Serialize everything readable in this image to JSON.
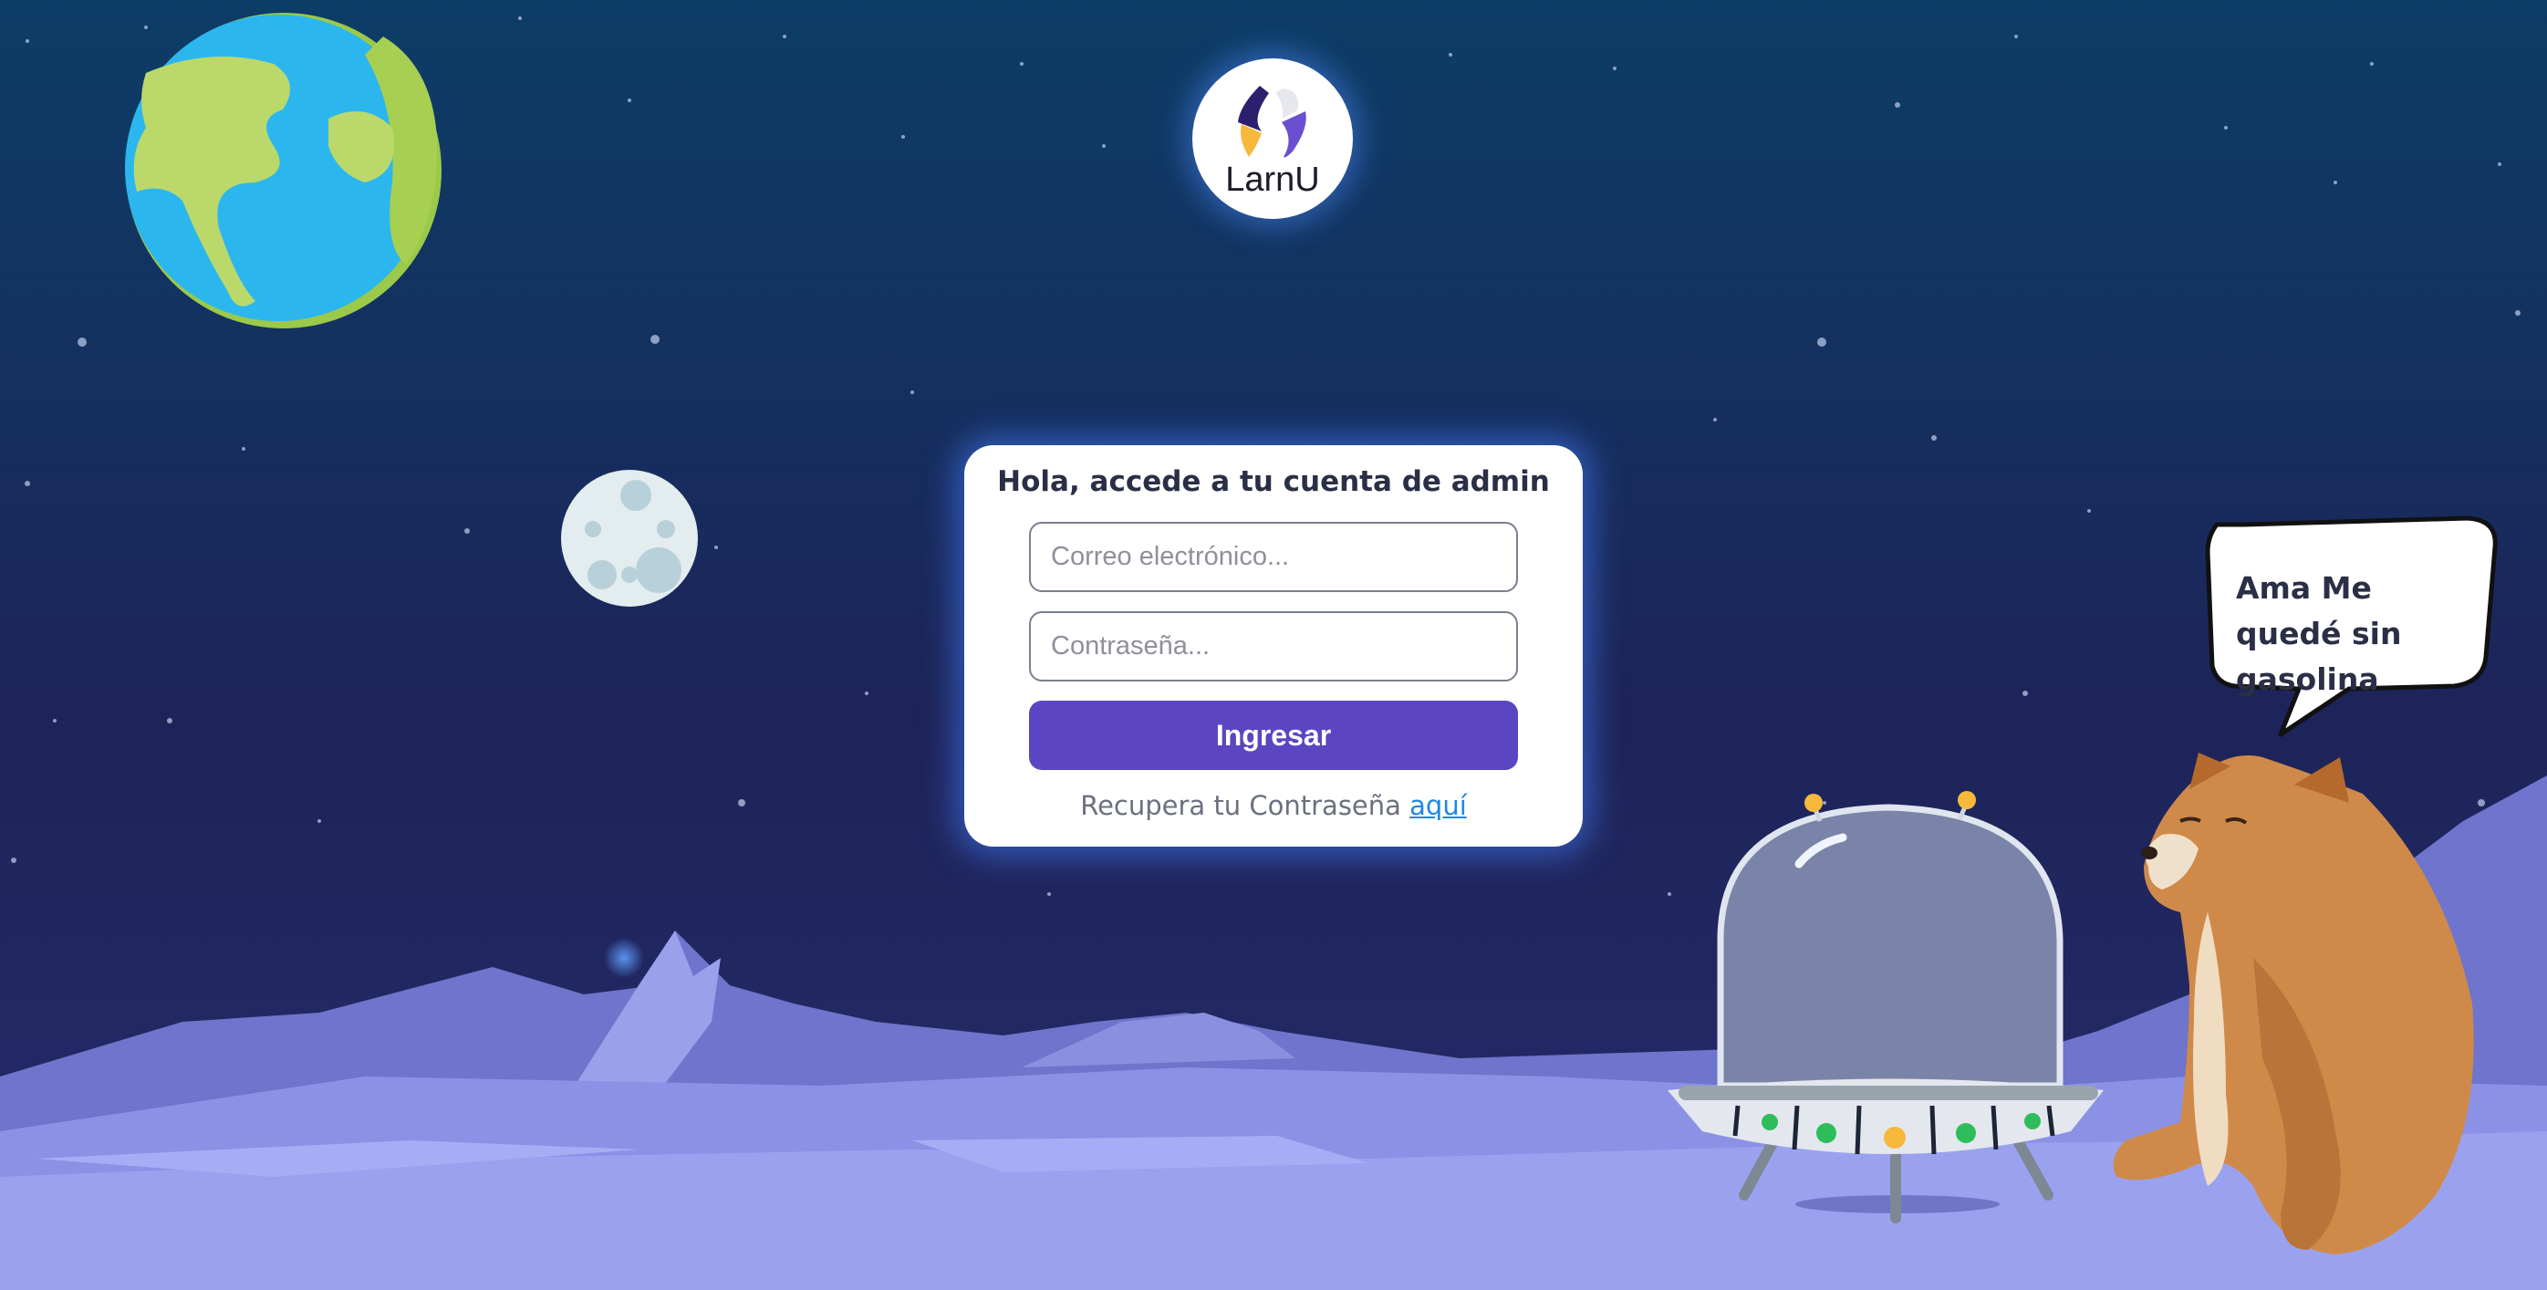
{
  "logo": {
    "text": "LarnU"
  },
  "login": {
    "title": "Hola, accede a tu cuenta de admin",
    "email_placeholder": "Correo electrónico...",
    "password_placeholder": "Contraseña...",
    "submit_label": "Ingresar",
    "recover_text": "Recupera tu Contraseña",
    "recover_link": "aquí"
  },
  "speech_bubble": {
    "text": "Ama Me quedé sin gasolina"
  },
  "colors": {
    "sky_top": "#0e3a66",
    "sky_bottom": "#1f2460",
    "button": "#5b45c2",
    "link": "#1e88e5",
    "ground": "#9aa2f0"
  }
}
